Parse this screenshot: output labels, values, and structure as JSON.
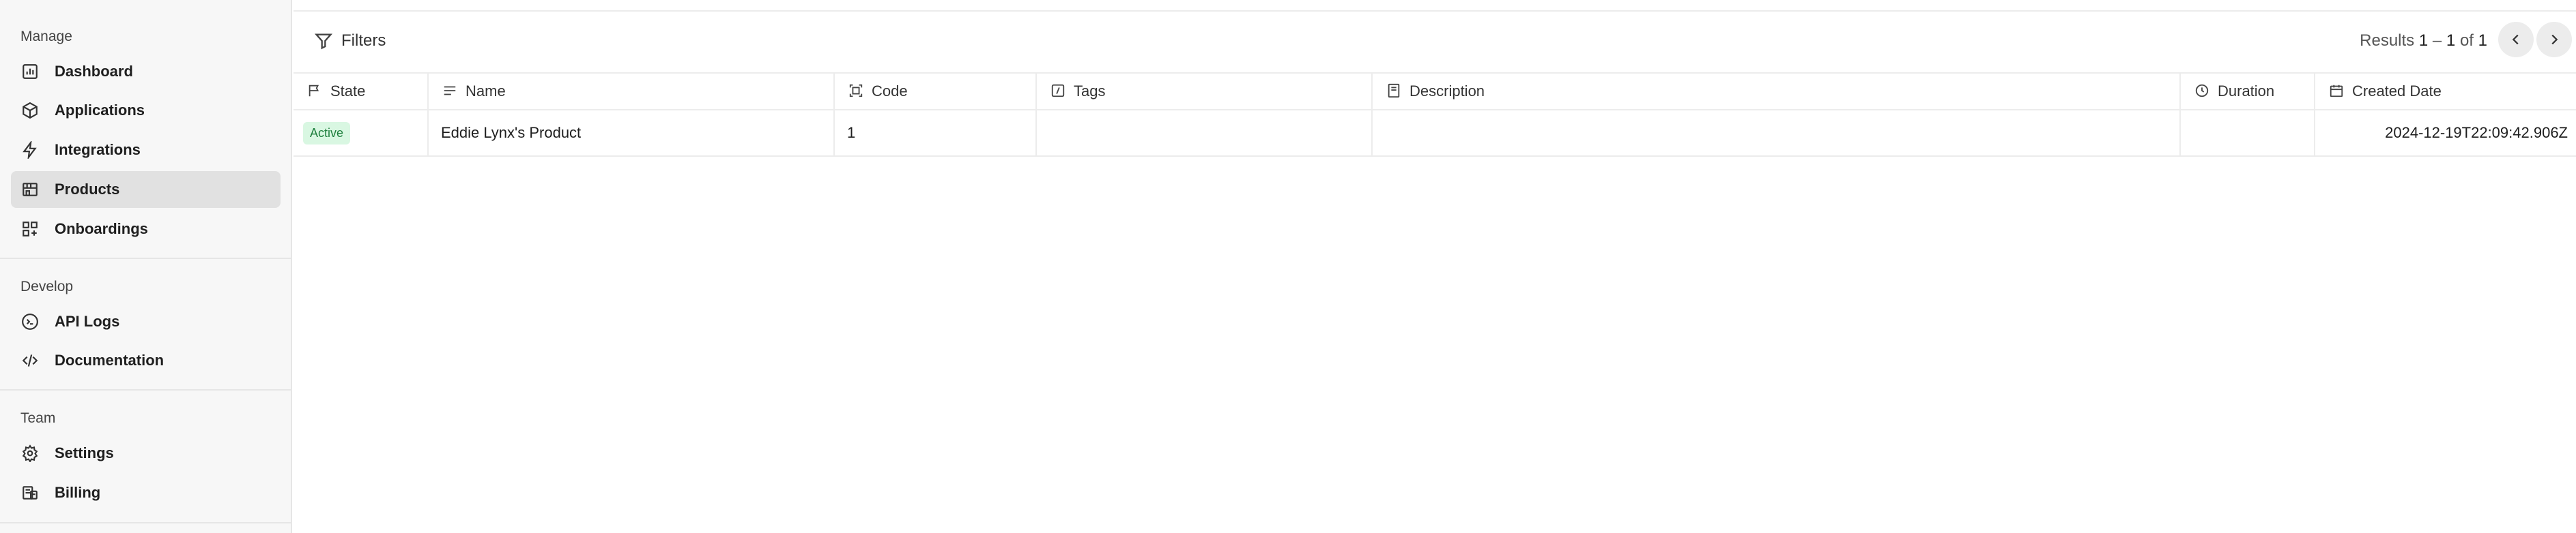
{
  "sidebar": {
    "sections": [
      {
        "label": "Manage",
        "items": [
          {
            "label": "Dashboard",
            "icon": "dashboard-icon"
          },
          {
            "label": "Applications",
            "icon": "cube-icon"
          },
          {
            "label": "Integrations",
            "icon": "lightning-icon"
          },
          {
            "label": "Products",
            "icon": "storefront-icon",
            "active": true
          },
          {
            "label": "Onboardings",
            "icon": "grid-add-icon"
          }
        ]
      },
      {
        "label": "Develop",
        "items": [
          {
            "label": "API Logs",
            "icon": "terminal-icon"
          },
          {
            "label": "Documentation",
            "icon": "code-icon"
          }
        ]
      },
      {
        "label": "Team",
        "items": [
          {
            "label": "Settings",
            "icon": "gear-icon"
          },
          {
            "label": "Billing",
            "icon": "billing-icon"
          }
        ]
      }
    ]
  },
  "toolbar": {
    "filters_label": "Filters",
    "results_prefix": "Results",
    "results_start": "1",
    "results_sep": "–",
    "results_end": "1",
    "results_of": "of",
    "results_total": "1"
  },
  "table": {
    "columns": [
      {
        "label": "State",
        "icon": "flag-icon"
      },
      {
        "label": "Name",
        "icon": "lines-icon"
      },
      {
        "label": "Code",
        "icon": "scan-icon"
      },
      {
        "label": "Tags",
        "icon": "tag-icon"
      },
      {
        "label": "Description",
        "icon": "document-icon"
      },
      {
        "label": "Duration",
        "icon": "clock-icon"
      },
      {
        "label": "Created Date",
        "icon": "calendar-icon"
      }
    ],
    "rows": [
      {
        "state": "Active",
        "name": "Eddie Lynx's Product",
        "code": "1",
        "tags": "",
        "description": "",
        "duration": "",
        "created_date": "2024-12-19T22:09:42.906Z"
      }
    ]
  },
  "colors": {
    "sidebar_bg": "#f7f7f7",
    "active_item_bg": "#e1e1e1",
    "badge_bg": "#d9f7e2",
    "badge_text": "#1e7f3d"
  }
}
